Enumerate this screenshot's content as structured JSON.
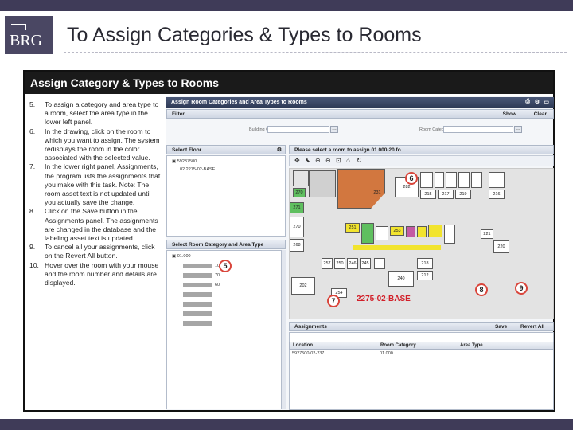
{
  "slide": {
    "logo": "BRG",
    "title": "To Assign Categories & Types to Rooms",
    "frame_title": "Assign Category & Types to Rooms"
  },
  "instructions": [
    {
      "num": "5.",
      "text": "To assign a category and area type to a room, select the area type in the lower left panel."
    },
    {
      "num": "6.",
      "text": "In the drawing, click on the room to which you want to assign. The system redisplays the room in the color associated with the selected value."
    },
    {
      "num": "7.",
      "text": "In the lower right panel, Assignments, the program lists the assignments that you make with this task. Note: The room asset text is not updated until you actually save the change."
    },
    {
      "num": "8.",
      "text": "Click on the Save button in the Assignments panel. The assignments are changed in the database and the labeling asset text is updated."
    },
    {
      "num": "9.",
      "text": "To cancel all your assignments, click on the Revert All button."
    },
    {
      "num": "10.",
      "text": "Hover over the room with your mouse and the room number and details are displayed."
    }
  ],
  "app": {
    "window_title": "Assign Room Categories and Area Types to Rooms",
    "filter_label": "Filter",
    "show_label": "Show",
    "clear_label": "Clear",
    "building_code_label": "Building Code",
    "room_category_label": "Room Category",
    "select_floor_label": "Select Floor",
    "floor_item_1": "59237500",
    "floor_item_2": "02 2275-02-BASE",
    "drawing_prompt": "Please select a room to assign 01.000-20 fo",
    "select_category_label": "Select Room Category and Area Type",
    "category_item": "01.000",
    "category_codes": [
      "10",
      "70",
      "60"
    ],
    "assignments_label": "Assignments",
    "save_label": "Save",
    "revert_label": "Revert All",
    "col_location": "Location",
    "col_category": "Room Category",
    "col_area_type": "Area Type",
    "row_location": "5927500-02-237",
    "row_category": "01.000",
    "floor_label": "2275-02-BASE"
  },
  "rooms": [
    {
      "label": "270",
      "color": "green"
    },
    {
      "label": "282",
      "color": "white"
    },
    {
      "label": "231",
      "color": "orange"
    },
    {
      "label": "271",
      "color": "green"
    },
    {
      "label": "215",
      "color": "white"
    },
    {
      "label": "217",
      "color": "white"
    },
    {
      "label": "219",
      "color": "white"
    },
    {
      "label": "216",
      "color": "white"
    },
    {
      "label": "270",
      "color": "white"
    },
    {
      "label": "268",
      "color": "white"
    },
    {
      "label": "251",
      "color": "white"
    },
    {
      "label": "253",
      "color": "white"
    },
    {
      "label": "257",
      "color": "white"
    },
    {
      "label": "250",
      "color": "white"
    },
    {
      "label": "246",
      "color": "white"
    },
    {
      "label": "245",
      "color": "white"
    },
    {
      "label": "240",
      "color": "white"
    },
    {
      "label": "202",
      "color": "white"
    },
    {
      "label": "254",
      "color": "white"
    },
    {
      "label": "221",
      "color": "white"
    },
    {
      "label": "220",
      "color": "white"
    },
    {
      "label": "218",
      "color": "white"
    },
    {
      "label": "212",
      "color": "white"
    }
  ],
  "callouts": [
    "5",
    "6",
    "7",
    "8",
    "9"
  ],
  "colors": {
    "header_bar": "#3f3b58",
    "frame_header": "#1a1a1a",
    "room_highlight": "#d2773f",
    "room_green": "#5fbf5f",
    "room_purple": "#c45aa3",
    "room_yellow": "#f2e42e",
    "callout_border": "#d9453b"
  }
}
